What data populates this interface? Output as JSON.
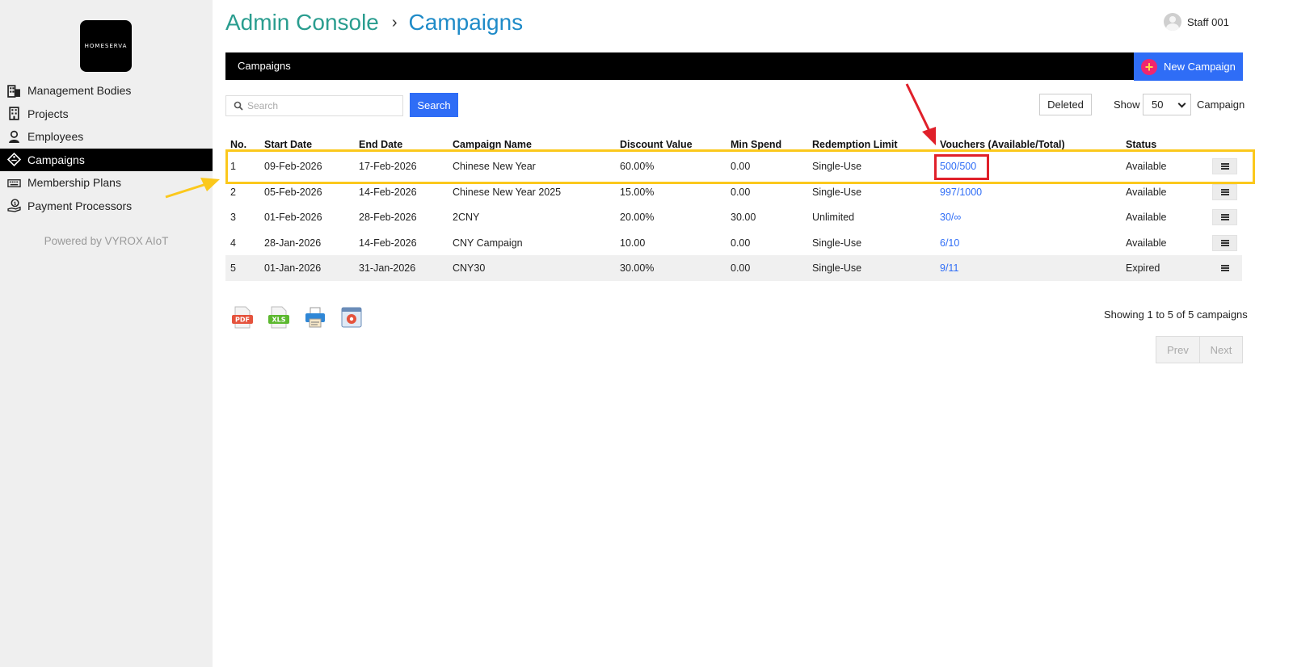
{
  "brand": {
    "logo_text": "HOMESERVA"
  },
  "sidebar": {
    "items": [
      {
        "label": "Management Bodies",
        "icon": "building-icon",
        "active": false
      },
      {
        "label": "Projects",
        "icon": "office-icon",
        "active": false
      },
      {
        "label": "Employees",
        "icon": "employee-icon",
        "active": false
      },
      {
        "label": "Campaigns",
        "icon": "tag-icon",
        "active": true
      },
      {
        "label": "Membership Plans",
        "icon": "keyboard-icon",
        "active": false
      },
      {
        "label": "Payment Processors",
        "icon": "payment-hand-icon",
        "active": false
      }
    ],
    "powered_by": "Powered by VYROX AIoT"
  },
  "header": {
    "breadcrumb_root": "Admin Console",
    "breadcrumb_separator": "›",
    "breadcrumb_current": "Campaigns",
    "user_name": "Staff 001"
  },
  "topbar": {
    "title": "Campaigns",
    "new_button_label": "New Campaign",
    "new_button_icon": "+"
  },
  "toolbar": {
    "search_placeholder": "Search",
    "search_button_label": "Search",
    "deleted_button_label": "Deleted",
    "show_label": "Show",
    "show_value": "50",
    "campaign_label": "Campaign"
  },
  "table": {
    "headers": {
      "no": "No.",
      "start": "Start Date",
      "end": "End Date",
      "name": "Campaign Name",
      "discount": "Discount Value",
      "min_spend": "Min Spend",
      "redemption": "Redemption Limit",
      "vouchers": "Vouchers (Available/Total)",
      "status": "Status"
    },
    "rows": [
      {
        "no": "1",
        "start": "09-Feb-2026",
        "end": "17-Feb-2026",
        "name": "Chinese New Year",
        "discount": "60.00%",
        "min_spend": "0.00",
        "redemption": "Single-Use",
        "vouchers": "500/500",
        "status": "Available"
      },
      {
        "no": "2",
        "start": "05-Feb-2026",
        "end": "14-Feb-2026",
        "name": "Chinese New Year 2025",
        "discount": "15.00%",
        "min_spend": "0.00",
        "redemption": "Single-Use",
        "vouchers": "997/1000",
        "status": "Available"
      },
      {
        "no": "3",
        "start": "01-Feb-2026",
        "end": "28-Feb-2026",
        "name": "2CNY",
        "discount": "20.00%",
        "min_spend": "30.00",
        "redemption": "Unlimited",
        "vouchers": "30/∞",
        "status": "Available"
      },
      {
        "no": "4",
        "start": "28-Jan-2026",
        "end": "14-Feb-2026",
        "name": "CNY Campaign",
        "discount": "10.00",
        "min_spend": "0.00",
        "redemption": "Single-Use",
        "vouchers": "6/10",
        "status": "Available"
      },
      {
        "no": "5",
        "start": "01-Jan-2026",
        "end": "31-Jan-2026",
        "name": "CNY30",
        "discount": "30.00%",
        "min_spend": "0.00",
        "redemption": "Single-Use",
        "vouchers": "9/11",
        "status": "Expired"
      }
    ]
  },
  "exports": {
    "pdf_label": "PDF",
    "xls_label": "XLS",
    "print_icon": "printer-icon",
    "settings_icon": "gear-window-icon"
  },
  "footer": {
    "showing_text": "Showing 1 to 5 of 5 campaigns",
    "prev_label": "Prev",
    "next_label": "Next"
  },
  "colors": {
    "teal": "#2a9d8f",
    "blue": "#2f6df6",
    "highlight_yellow": "#fbc81c",
    "highlight_red": "#e0202a"
  }
}
